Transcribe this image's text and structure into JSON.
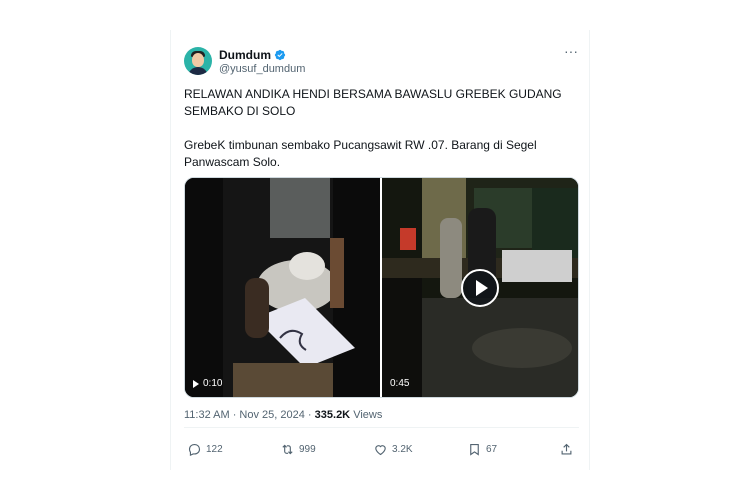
{
  "author": {
    "display_name": "Dumdum",
    "handle": "@yusuf_dumdum",
    "verified": true
  },
  "tweet": {
    "line1": "RELAWAN ANDIKA HENDI BERSAMA BAWASLU GREBEK GUDANG",
    "line2": "SEMBAKO DI SOLO",
    "line3": "GrebeK timbunan sembako Pucangsawit  RW .07. Barang di Segel",
    "line4": "Panwascam Solo."
  },
  "media": {
    "video1_duration": "0:10",
    "video2_duration": "0:45"
  },
  "meta": {
    "time_date": "11:32 AM · Nov 25, 2024 · ",
    "views_count": "335.2K",
    "views_label": " Views"
  },
  "actions": {
    "replies": "122",
    "reposts": "999",
    "likes": "3.2K",
    "bookmarks": "67"
  },
  "colors": {
    "verified": "#1d9bf0",
    "secondary_text": "#536471",
    "primary_text": "#0f1419"
  },
  "icons": [
    "verified-badge-icon",
    "more-icon",
    "play-icon",
    "reply-icon",
    "repost-icon",
    "like-icon",
    "bookmark-icon",
    "share-icon"
  ]
}
